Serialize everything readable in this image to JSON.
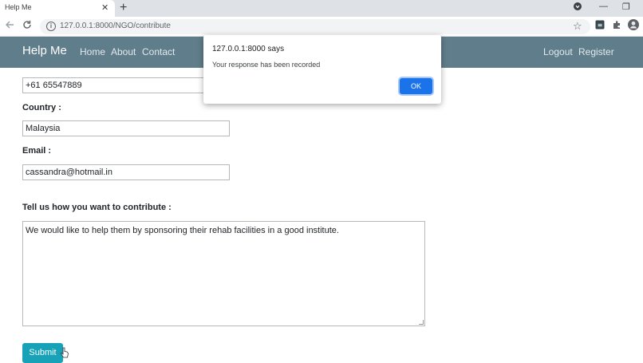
{
  "browser": {
    "tab_title": "Help Me",
    "tab_close": "✕",
    "new_tab": "+",
    "url": "127.0.0.1:8000/NGO/contribute",
    "window_controls": [
      "—",
      "❐"
    ]
  },
  "navbar": {
    "brand": "Help Me",
    "links": [
      "Home",
      "About",
      "Contact"
    ],
    "right_links": [
      "Logout",
      "Register"
    ],
    "background": "#607d8b"
  },
  "form": {
    "phone_value": "+61 65547889",
    "country_label": "Country :",
    "country_value": "Malaysia",
    "email_label": "Email :",
    "email_value": "cassandra@hotmail.in",
    "contribute_label": "Tell us how you want to contribute :",
    "contribute_value": "We would like to help them by sponsoring their rehab facilities in a good institute.",
    "submit_label": "Submit",
    "submit_color": "#17a2b8"
  },
  "dialog": {
    "title": "127.0.0.1:8000 says",
    "message": "Your response has been recorded",
    "ok_label": "OK",
    "ok_color": "#1a73e8"
  },
  "icons": [
    "back-arrow-icon",
    "reload-icon",
    "info-icon",
    "star-icon",
    "extension-icon",
    "puzzle-icon",
    "profile-avatar-icon",
    "mouse-cursor-icon"
  ]
}
